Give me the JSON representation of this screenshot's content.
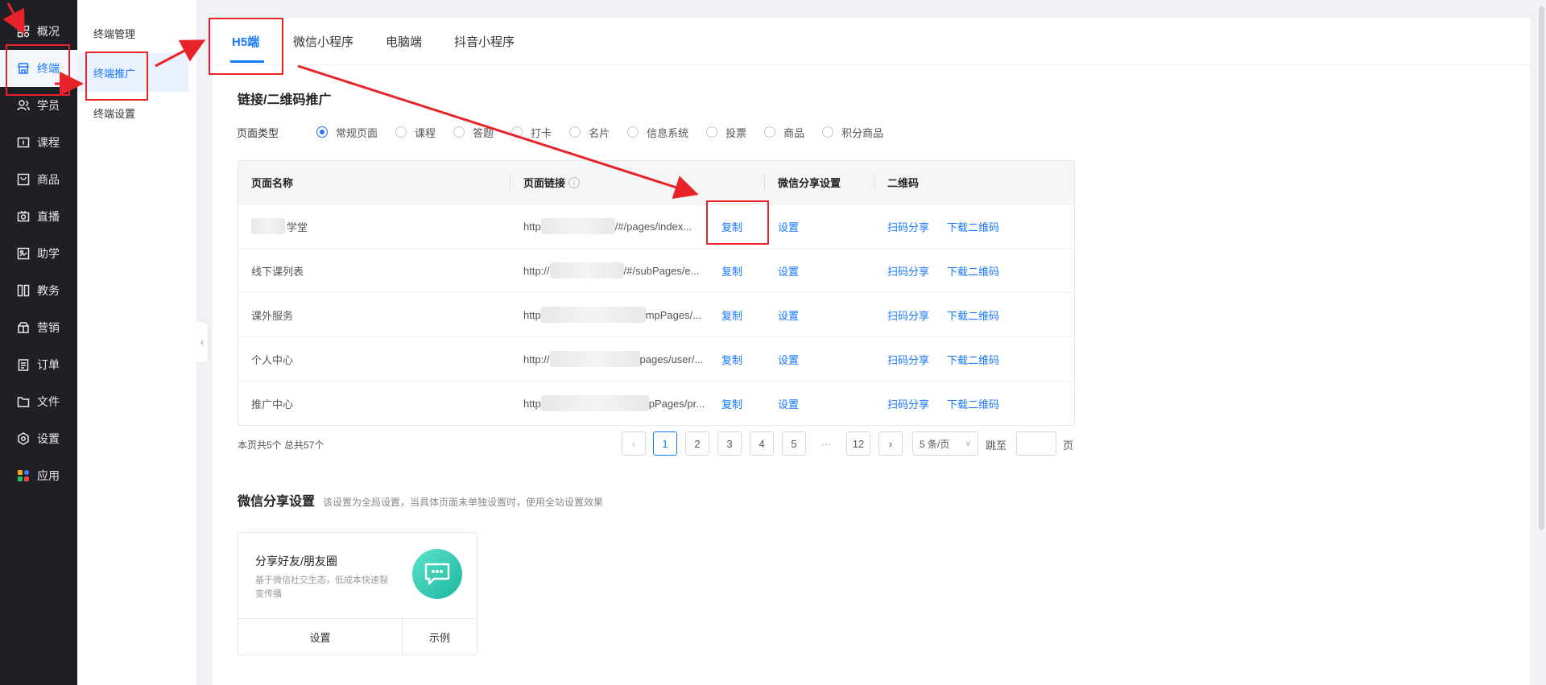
{
  "nav": {
    "items": [
      {
        "label": "概况",
        "icon": "dashboard-icon"
      },
      {
        "label": "终端",
        "icon": "store-icon"
      },
      {
        "label": "学员",
        "icon": "users-icon"
      },
      {
        "label": "课程",
        "icon": "course-icon"
      },
      {
        "label": "商品",
        "icon": "goods-icon"
      },
      {
        "label": "直播",
        "icon": "live-icon"
      },
      {
        "label": "助学",
        "icon": "assist-icon"
      },
      {
        "label": "教务",
        "icon": "academic-icon"
      },
      {
        "label": "营销",
        "icon": "marketing-icon"
      },
      {
        "label": "订单",
        "icon": "order-icon"
      },
      {
        "label": "文件",
        "icon": "folder-icon"
      },
      {
        "label": "设置",
        "icon": "gear-icon"
      },
      {
        "label": "应用",
        "icon": "apps-icon"
      }
    ]
  },
  "subnav": {
    "items": [
      {
        "label": "终端管理"
      },
      {
        "label": "终端推广"
      },
      {
        "label": "终端设置"
      }
    ]
  },
  "tabs": [
    {
      "label": "H5端"
    },
    {
      "label": "微信小程序"
    },
    {
      "label": "电脑端"
    },
    {
      "label": "抖音小程序"
    }
  ],
  "promo": {
    "title": "链接/二维码推广",
    "page_type_label": "页面类型",
    "page_types": [
      "常规页面",
      "课程",
      "答题",
      "打卡",
      "名片",
      "信息系统",
      "投票",
      "商品",
      "积分商品"
    ]
  },
  "table": {
    "headers": [
      "页面名称",
      "页面链接",
      "微信分享设置",
      "二维码"
    ],
    "rows": [
      {
        "name": "学堂",
        "link_start": "http",
        "link_end": "/#/pages/index...",
        "copy": "复制",
        "setting": "设置",
        "scan": "扫码分享",
        "download": "下载二维码"
      },
      {
        "name": "线下课列表",
        "link_start": "http://",
        "link_end": "/#/subPages/e...",
        "copy": "复制",
        "setting": "设置",
        "scan": "扫码分享",
        "download": "下载二维码"
      },
      {
        "name": "课外服务",
        "link_start": "http",
        "link_end": "mpPages/...",
        "copy": "复制",
        "setting": "设置",
        "scan": "扫码分享",
        "download": "下载二维码"
      },
      {
        "name": "个人中心",
        "link_start": "http://",
        "link_end": "pages/user/...",
        "copy": "复制",
        "setting": "设置",
        "scan": "扫码分享",
        "download": "下载二维码"
      },
      {
        "name": "推广中心",
        "link_start": "http",
        "link_end": "pPages/pr...",
        "copy": "复制",
        "setting": "设置",
        "scan": "扫码分享",
        "download": "下载二维码"
      }
    ]
  },
  "pagination": {
    "info": "本页共5个 总共57个",
    "pages": [
      "1",
      "2",
      "3",
      "4",
      "5",
      "···",
      "12"
    ],
    "page_size": "5 条/页",
    "jump_label": "跳至",
    "page_suffix": "页"
  },
  "share": {
    "title": "微信分享设置",
    "desc": "该设置为全局设置，当具体页面未单独设置时，使用全站设置效果",
    "card": {
      "title": "分享好友/朋友圈",
      "desc": "基于微信社交生态，低成本快速裂变传播",
      "btn_setting": "设置",
      "btn_example": "示例"
    }
  },
  "colors": {
    "accent": "#1677ff",
    "annotation": "#e8232a",
    "nav_bg": "#1f2026"
  }
}
